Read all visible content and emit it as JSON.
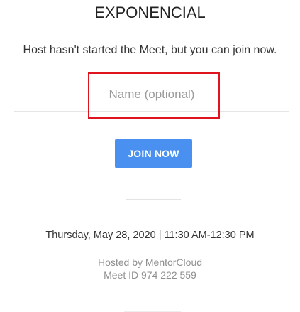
{
  "header": {
    "title": "EXPONENCIAL",
    "subtitle": "Host hasn't started the Meet, but you can join now."
  },
  "join_form": {
    "name_placeholder": "Name (optional)",
    "name_value": "",
    "join_label": "JOIN NOW"
  },
  "meeting": {
    "time": "Thursday, May 28, 2020 | 11:30 AM-12:30 PM",
    "hosted_by": "Hosted by MentorCloud",
    "meet_id": "Meet ID 974 222 559"
  },
  "colors": {
    "accent": "#4a90f0",
    "highlight": "#e0141e",
    "muted_text": "#8f8f8f"
  }
}
